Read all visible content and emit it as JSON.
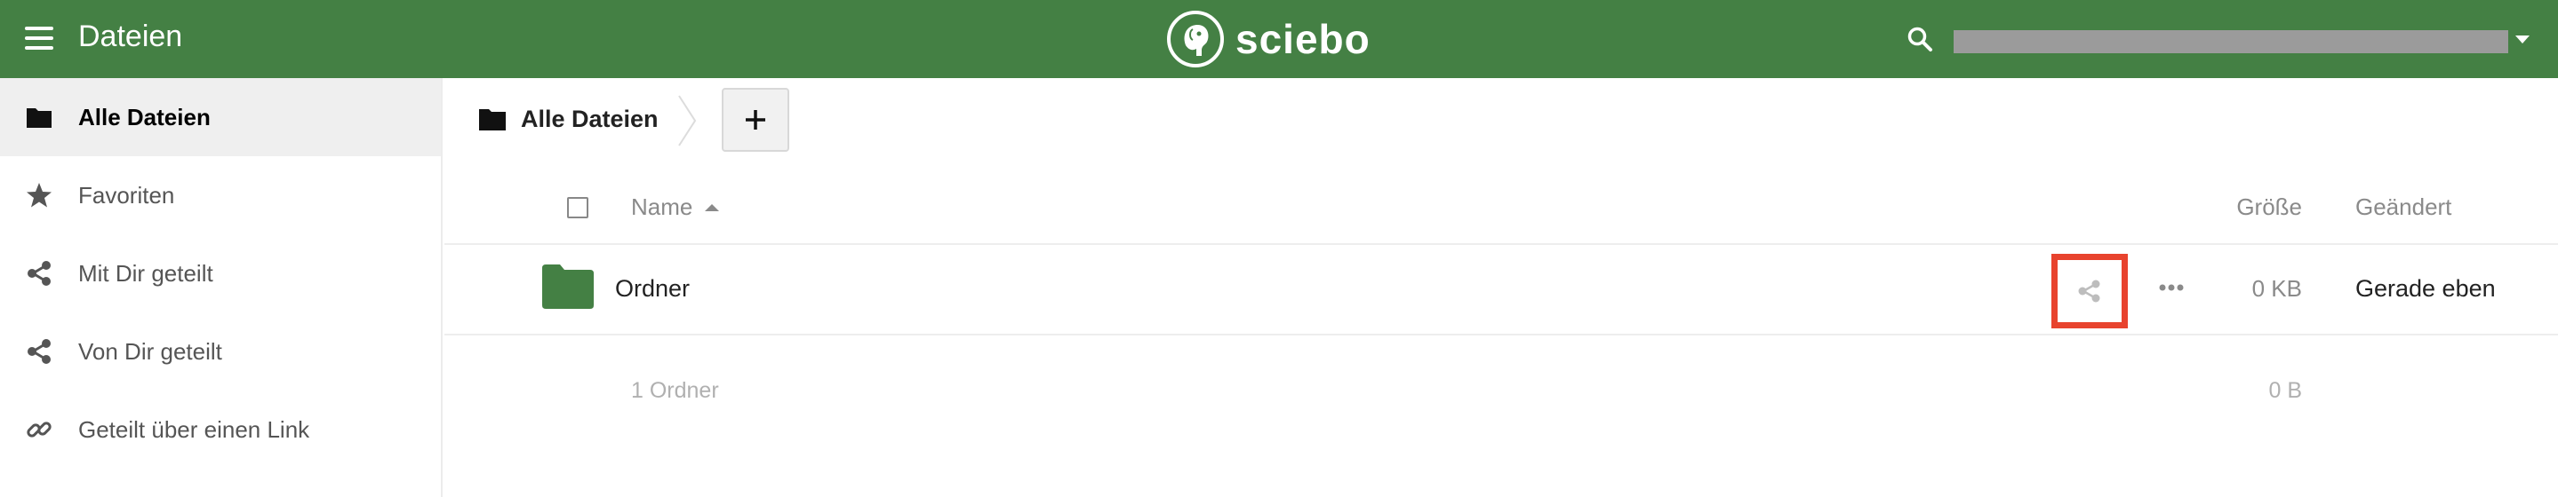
{
  "colors": {
    "brand": "#448044",
    "highlight": "#e8432e"
  },
  "header": {
    "app_title": "Dateien",
    "logo_text": "sciebo",
    "menu_icon": "hamburger-icon",
    "search_icon": "search-icon"
  },
  "sidebar": {
    "items": [
      {
        "label": "Alle Dateien",
        "icon": "folder-icon",
        "active": true
      },
      {
        "label": "Favoriten",
        "icon": "star-icon",
        "active": false
      },
      {
        "label": "Mit Dir geteilt",
        "icon": "share-icon",
        "active": false
      },
      {
        "label": "Von Dir geteilt",
        "icon": "share-icon",
        "active": false
      },
      {
        "label": "Geteilt über einen Link",
        "icon": "link-icon",
        "active": false
      }
    ]
  },
  "breadcrumb": {
    "label": "Alle Dateien"
  },
  "new_button": {
    "label": "+"
  },
  "table": {
    "columns": {
      "name": "Name",
      "size": "Größe",
      "modified": "Geändert"
    },
    "rows": [
      {
        "name": "Ordner",
        "size": "0 KB",
        "modified": "Gerade eben",
        "icon": "folder-icon"
      }
    ],
    "summary": {
      "count": "1 Ordner",
      "size": "0 B"
    }
  }
}
